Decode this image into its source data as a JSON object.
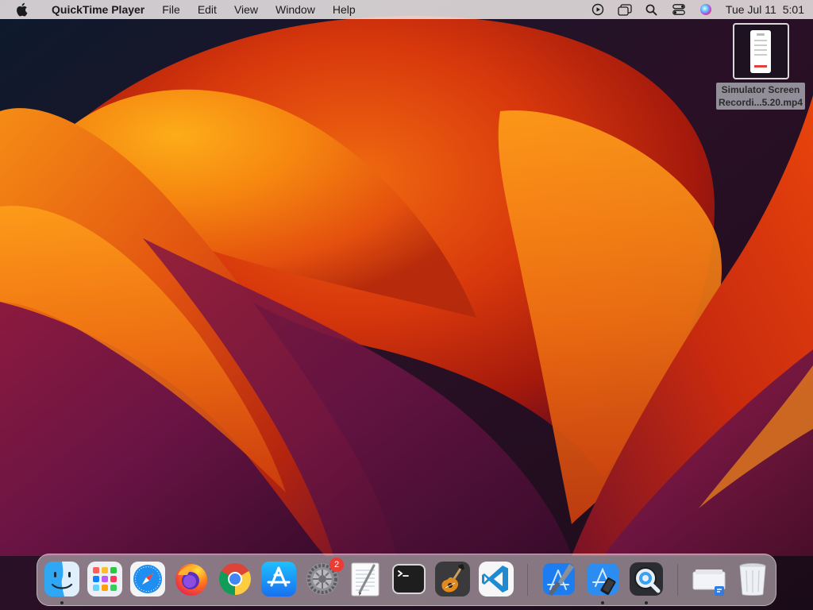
{
  "menubar": {
    "app_name": "QuickTime Player",
    "menus": [
      "File",
      "Edit",
      "View",
      "Window",
      "Help"
    ],
    "clock_date": "Tue Jul 11",
    "clock_time": "5:01",
    "status_icons": [
      "screen-recording-icon",
      "window-switcher-icon",
      "spotlight-search-icon",
      "control-center-icon",
      "siri-icon"
    ]
  },
  "desktop_file": {
    "name_line1": "Simulator Screen",
    "name_line2": "Recordi...5.20.mp4"
  },
  "dock": {
    "apps": [
      {
        "id": "finder",
        "icon": "finder-icon",
        "running": true
      },
      {
        "id": "launchpad",
        "icon": "launchpad-icon",
        "running": false
      },
      {
        "id": "safari",
        "icon": "safari-icon",
        "running": false
      },
      {
        "id": "firefox",
        "icon": "firefox-icon",
        "running": false
      },
      {
        "id": "chrome",
        "icon": "chrome-icon",
        "running": false
      },
      {
        "id": "app-store",
        "icon": "app-store-icon",
        "running": false
      },
      {
        "id": "system-settings",
        "icon": "system-settings-icon",
        "running": false,
        "badge": "2"
      },
      {
        "id": "textedit",
        "icon": "textedit-icon",
        "running": false
      },
      {
        "id": "terminal",
        "icon": "terminal-icon",
        "running": false
      },
      {
        "id": "garageband",
        "icon": "garageband-icon",
        "running": false
      },
      {
        "id": "vscode",
        "icon": "vscode-icon",
        "running": false
      },
      {
        "id": "xcode",
        "icon": "xcode-icon",
        "running": false
      },
      {
        "id": "simulator",
        "icon": "simulator-icon",
        "running": true
      },
      {
        "id": "quicktime",
        "icon": "quicktime-icon",
        "running": true
      },
      {
        "id": "downloads-stack",
        "icon": "downloads-stack-icon",
        "running": false
      },
      {
        "id": "trash",
        "icon": "trash-icon",
        "running": false
      }
    ]
  },
  "colors": {
    "menubar_bg": "#eee8e8",
    "wallpaper_orange": "#f57a0c",
    "wallpaper_red": "#c8210c",
    "wallpaper_purple": "#5a0f3c",
    "badge_red": "#ec3b33"
  }
}
